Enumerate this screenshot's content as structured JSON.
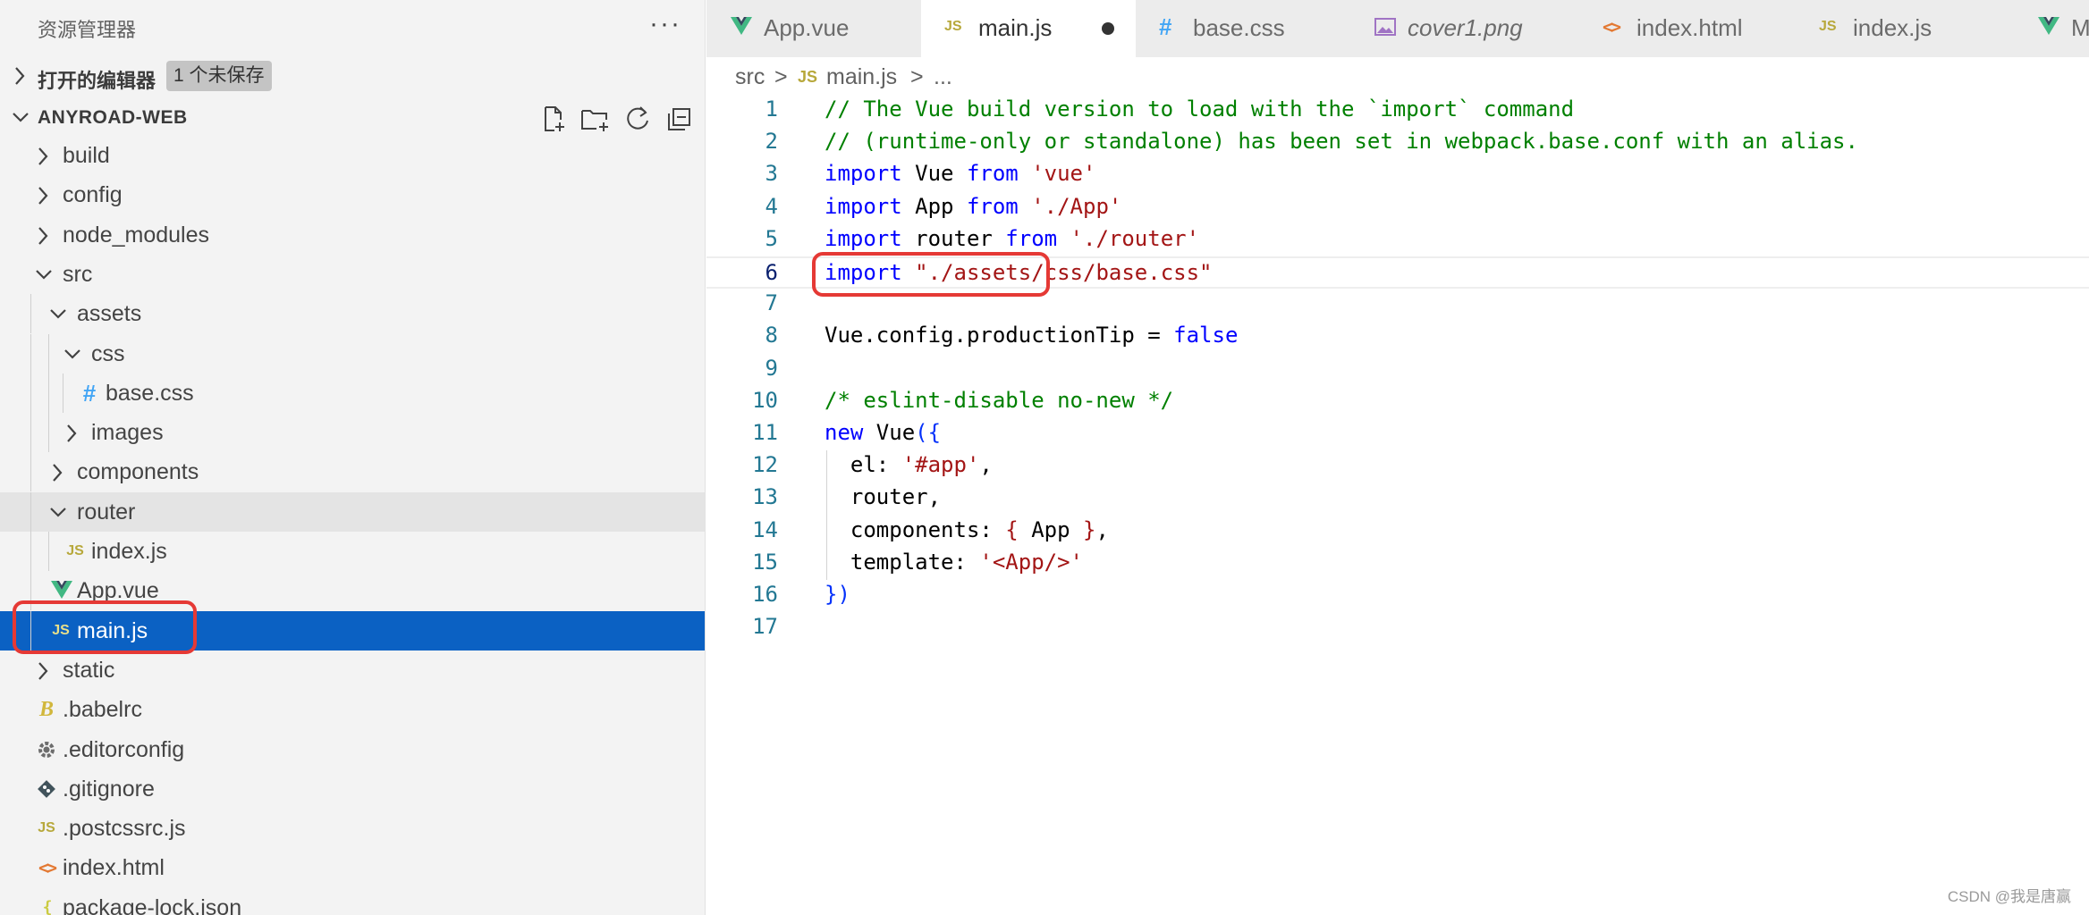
{
  "sidebar": {
    "title": "资源管理器",
    "more_label": "···",
    "open_editors_label": "打开的编辑器",
    "unsaved_badge": "1 个未保存",
    "project_name": "ANYROAD-WEB",
    "header_actions": [
      "new-file-icon",
      "new-folder-icon",
      "refresh-icon",
      "collapse-all-icon"
    ],
    "tree": [
      {
        "label": "build",
        "kind": "folder",
        "expanded": false
      },
      {
        "label": "config",
        "kind": "folder",
        "expanded": false
      },
      {
        "label": "node_modules",
        "kind": "folder",
        "expanded": false
      },
      {
        "label": "src",
        "kind": "folder",
        "expanded": true
      },
      {
        "label": "assets",
        "kind": "folder",
        "expanded": true
      },
      {
        "label": "css",
        "kind": "folder",
        "expanded": true
      },
      {
        "label": "base.css",
        "kind": "file",
        "icon": "css-hash-icon"
      },
      {
        "label": "images",
        "kind": "folder",
        "expanded": false
      },
      {
        "label": "components",
        "kind": "folder",
        "expanded": false
      },
      {
        "label": "router",
        "kind": "folder",
        "expanded": true
      },
      {
        "label": "index.js",
        "kind": "file",
        "icon": "js-icon"
      },
      {
        "label": "App.vue",
        "kind": "file",
        "icon": "vue-icon"
      },
      {
        "label": "main.js",
        "kind": "file",
        "icon": "js-icon",
        "selected": true
      },
      {
        "label": "static",
        "kind": "folder",
        "expanded": false
      },
      {
        "label": ".babelrc",
        "kind": "file",
        "icon": "babel-icon"
      },
      {
        "label": ".editorconfig",
        "kind": "file",
        "icon": "gear-icon"
      },
      {
        "label": ".gitignore",
        "kind": "file",
        "icon": "git-icon"
      },
      {
        "label": ".postcssrc.js",
        "kind": "file",
        "icon": "js-icon"
      },
      {
        "label": "index.html",
        "kind": "file",
        "icon": "html-icon"
      },
      {
        "label": "package-lock.json",
        "kind": "file",
        "icon": "json-icon"
      }
    ]
  },
  "tabs": [
    {
      "label": "App.vue",
      "icon": "vue-icon",
      "active": false
    },
    {
      "label": "main.js",
      "icon": "js-icon",
      "active": true,
      "dirty": true
    },
    {
      "label": "base.css",
      "icon": "css-hash-icon",
      "active": false
    },
    {
      "label": "cover1.png",
      "icon": "image-icon",
      "active": false,
      "preview": true
    },
    {
      "label": "index.html",
      "icon": "html-icon",
      "active": false
    },
    {
      "label": "index.js",
      "icon": "js-icon",
      "active": false
    },
    {
      "label": "M",
      "icon": "vue-icon",
      "active": false
    }
  ],
  "breadcrumb": {
    "folder": "src",
    "sep": ">",
    "file": "main.js",
    "more": "..."
  },
  "icon_labels": {
    "js": "JS",
    "css": "#",
    "json": "{ }",
    "html": "<>",
    "babel": "B"
  },
  "code": {
    "active_line": 6,
    "lines": [
      {
        "n": "1",
        "tokens": [
          {
            "t": "// The Vue build version to load with the `import` command",
            "c": "comment"
          }
        ]
      },
      {
        "n": "2",
        "tokens": [
          {
            "t": "// (runtime-only or standalone) has been set in webpack.base.conf with an alias.",
            "c": "comment"
          }
        ]
      },
      {
        "n": "3",
        "tokens": [
          {
            "t": "import",
            "c": "keyword"
          },
          {
            "t": " Vue ",
            "c": "plain"
          },
          {
            "t": "from",
            "c": "keyword"
          },
          {
            "t": " ",
            "c": "plain"
          },
          {
            "t": "'vue'",
            "c": "string"
          }
        ]
      },
      {
        "n": "4",
        "tokens": [
          {
            "t": "import",
            "c": "keyword"
          },
          {
            "t": " App ",
            "c": "plain"
          },
          {
            "t": "from",
            "c": "keyword"
          },
          {
            "t": " ",
            "c": "plain"
          },
          {
            "t": "'./App'",
            "c": "string"
          }
        ]
      },
      {
        "n": "5",
        "tokens": [
          {
            "t": "import",
            "c": "keyword"
          },
          {
            "t": " router ",
            "c": "plain"
          },
          {
            "t": "from",
            "c": "keyword"
          },
          {
            "t": " ",
            "c": "plain"
          },
          {
            "t": "'./router'",
            "c": "string"
          }
        ]
      },
      {
        "n": "6",
        "tokens": [
          {
            "t": "import",
            "c": "keyword"
          },
          {
            "t": " ",
            "c": "plain"
          },
          {
            "t": "\"./assets/css/base.css\"",
            "c": "string"
          }
        ]
      },
      {
        "n": "7",
        "tokens": []
      },
      {
        "n": "8",
        "tokens": [
          {
            "t": "Vue.config.productionTip = ",
            "c": "plain"
          },
          {
            "t": "false",
            "c": "keyword"
          }
        ]
      },
      {
        "n": "9",
        "tokens": []
      },
      {
        "n": "10",
        "tokens": [
          {
            "t": "/* eslint-disable no-new */",
            "c": "comment"
          }
        ]
      },
      {
        "n": "11",
        "tokens": [
          {
            "t": "new",
            "c": "keyword"
          },
          {
            "t": " Vue",
            "c": "plain"
          },
          {
            "t": "({",
            "c": "brace"
          }
        ]
      },
      {
        "n": "12",
        "tokens": [
          {
            "t": "  el: ",
            "c": "plain"
          },
          {
            "t": "'#app'",
            "c": "string"
          },
          {
            "t": ",",
            "c": "plain"
          }
        ]
      },
      {
        "n": "13",
        "tokens": [
          {
            "t": "  router,",
            "c": "plain"
          }
        ]
      },
      {
        "n": "14",
        "tokens": [
          {
            "t": "  components: ",
            "c": "plain"
          },
          {
            "t": "{",
            "c": "string"
          },
          {
            "t": " App ",
            "c": "plain"
          },
          {
            "t": "}",
            "c": "string"
          },
          {
            "t": ",",
            "c": "plain"
          }
        ]
      },
      {
        "n": "15",
        "tokens": [
          {
            "t": "  template: ",
            "c": "plain"
          },
          {
            "t": "'<App/>'",
            "c": "string"
          }
        ]
      },
      {
        "n": "16",
        "tokens": [
          {
            "t": "})",
            "c": "brace"
          }
        ]
      },
      {
        "n": "17",
        "tokens": []
      }
    ]
  },
  "colors": {
    "selection": "#0b61c3",
    "annotation_red": "#e53935",
    "comment": "#008000",
    "keyword": "#0000ff",
    "string": "#a31515"
  },
  "watermark": "CSDN @我是唐赢"
}
